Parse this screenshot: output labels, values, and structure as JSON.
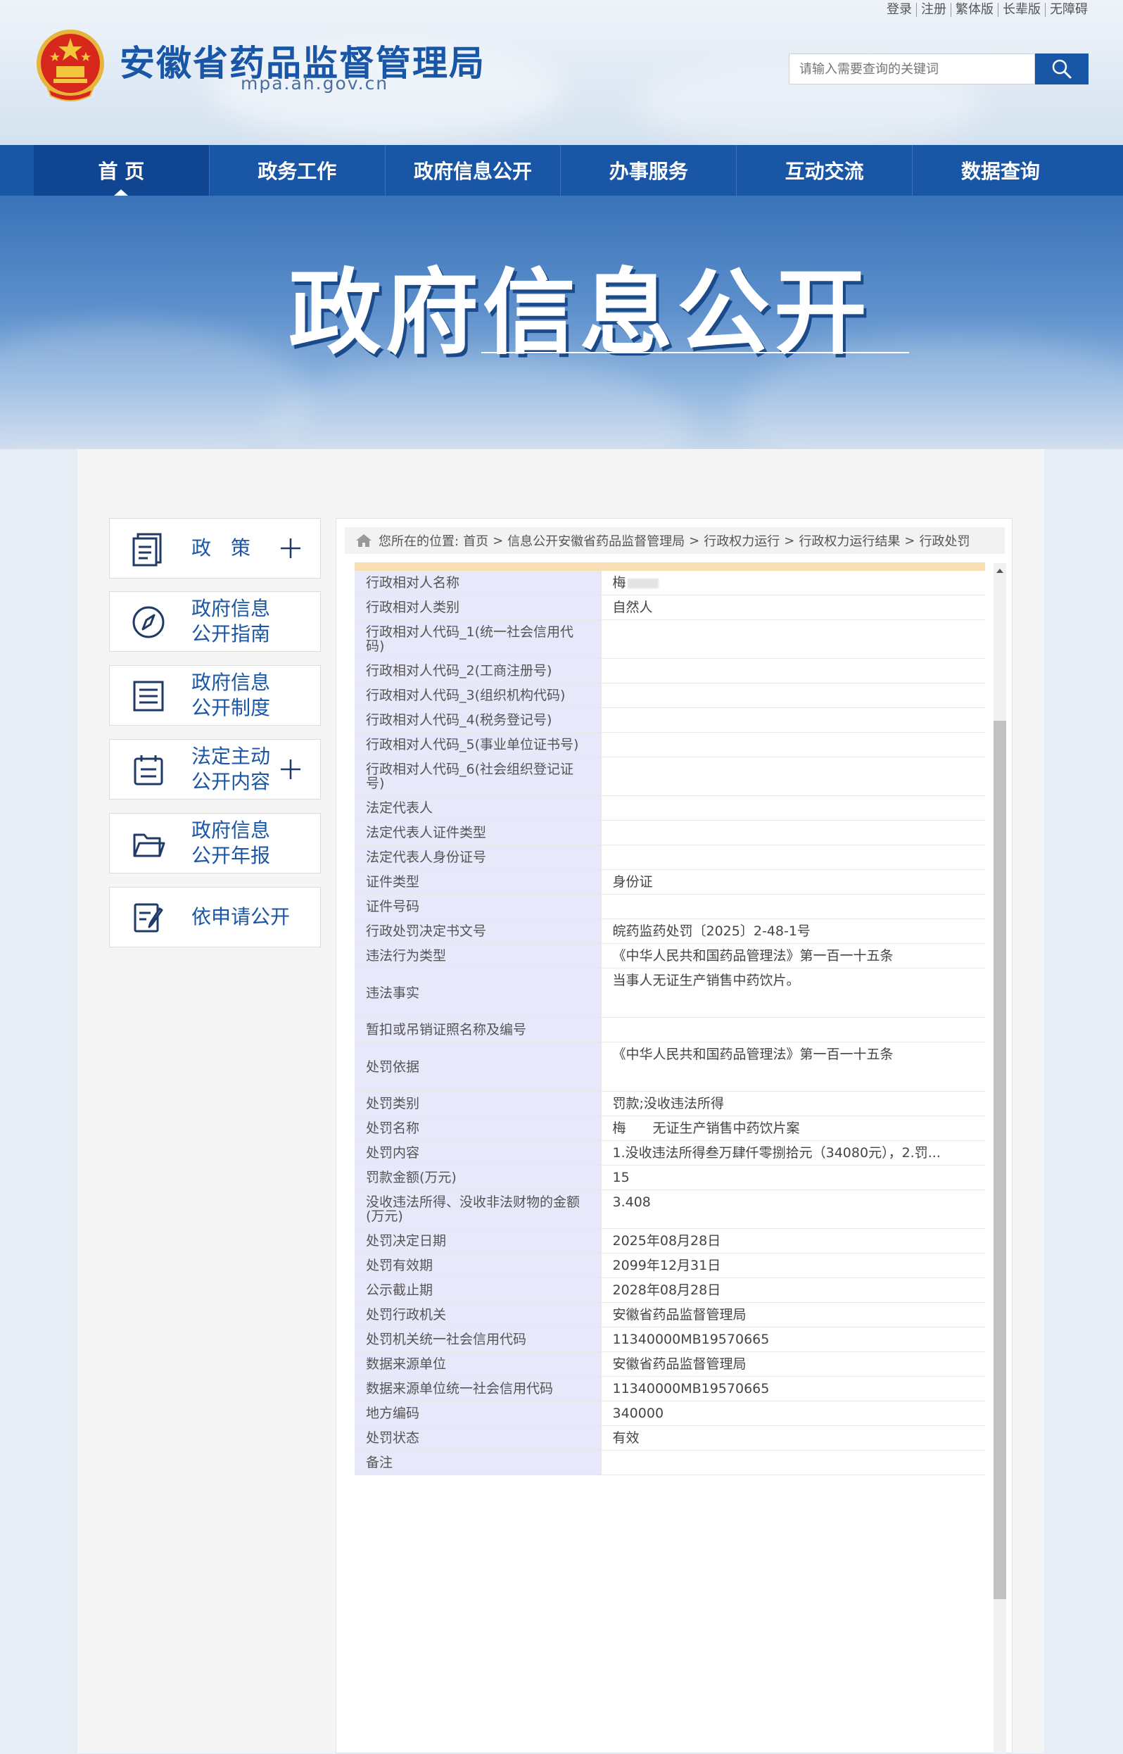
{
  "header": {
    "top_links": [
      "登录",
      "注册",
      "繁体版",
      "长辈版",
      "无障碍"
    ],
    "site_title": "安徽省药品监督管理局",
    "site_url": "mpa.ah.gov.cn",
    "search_placeholder": "请输入需要查询的关键词"
  },
  "nav": {
    "items": [
      "首 页",
      "政务工作",
      "政府信息公开",
      "办事服务",
      "互动交流",
      "数据查询"
    ],
    "active": 0
  },
  "banner": {
    "title": "政府信息公开"
  },
  "sidebar": {
    "items": [
      {
        "label": "政　策",
        "icon": "document-stack-icon",
        "expandable": true
      },
      {
        "label": "政府信息公开指南",
        "icon": "compass-icon",
        "expandable": false
      },
      {
        "label": "政府信息公开制度",
        "icon": "list-document-icon",
        "expandable": false
      },
      {
        "label": "法定主动公开内容",
        "icon": "clipboard-icon",
        "expandable": true
      },
      {
        "label": "政府信息公开年报",
        "icon": "folder-icon",
        "expandable": false
      },
      {
        "label": "依申请公开",
        "icon": "edit-form-icon",
        "expandable": false
      }
    ]
  },
  "breadcrumb": {
    "prefix": "您所在的位置:",
    "items": [
      "首页",
      "信息公开安徽省药品监督管理局",
      "行政权力运行",
      "行政权力运行结果",
      "行政处罚"
    ],
    "separator": ">"
  },
  "record": {
    "rows": [
      {
        "key": "行政相对人名称",
        "value": "梅",
        "redacted": true
      },
      {
        "key": "行政相对人类别",
        "value": "自然人"
      },
      {
        "key": "行政相对人代码_1(统一社会信用代码)",
        "value": ""
      },
      {
        "key": "行政相对人代码_2(工商注册号)",
        "value": ""
      },
      {
        "key": "行政相对人代码_3(组织机构代码)",
        "value": ""
      },
      {
        "key": "行政相对人代码_4(税务登记号)",
        "value": ""
      },
      {
        "key": "行政相对人代码_5(事业单位证书号)",
        "value": ""
      },
      {
        "key": "行政相对人代码_6(社会组织登记证号)",
        "value": ""
      },
      {
        "key": "法定代表人",
        "value": ""
      },
      {
        "key": "法定代表人证件类型",
        "value": ""
      },
      {
        "key": "法定代表人身份证号",
        "value": ""
      },
      {
        "key": "证件类型",
        "value": "身份证"
      },
      {
        "key": "证件号码",
        "value": ""
      },
      {
        "key": "行政处罚决定书文号",
        "value": "皖药监药处罚〔2025〕2-48-1号"
      },
      {
        "key": "违法行为类型",
        "value": "《中华人民共和国药品管理法》第一百一十五条"
      },
      {
        "key": "违法事实",
        "value": "当事人无证生产销售中药饮片。",
        "tall": true
      },
      {
        "key": "暂扣或吊销证照名称及编号",
        "value": ""
      },
      {
        "key": "处罚依据",
        "value": "《中华人民共和国药品管理法》第一百一十五条",
        "tall": true
      },
      {
        "key": "处罚类别",
        "value": "罚款;没收违法所得"
      },
      {
        "key": "处罚名称",
        "value": "梅　　无证生产销售中药饮片案",
        "redacted": true
      },
      {
        "key": "处罚内容",
        "value": "1.没收违法所得叁万肆仟零捌拾元（34080元），2.罚..."
      },
      {
        "key": "罚款金额(万元)",
        "value": "15"
      },
      {
        "key": "没收违法所得、没收非法财物的金额(万元)",
        "value": "3.408"
      },
      {
        "key": "处罚决定日期",
        "value": "2025年08月28日"
      },
      {
        "key": "处罚有效期",
        "value": "2099年12月31日"
      },
      {
        "key": "公示截止期",
        "value": "2028年08月28日"
      },
      {
        "key": "处罚行政机关",
        "value": "安徽省药品监督管理局"
      },
      {
        "key": "处罚机关统一社会信用代码",
        "value": "11340000MB19570665"
      },
      {
        "key": "数据来源单位",
        "value": "安徽省药品监督管理局"
      },
      {
        "key": "数据来源单位统一社会信用代码",
        "value": "11340000MB19570665"
      },
      {
        "key": "地方编码",
        "value": "340000"
      },
      {
        "key": "处罚状态",
        "value": "有效"
      },
      {
        "key": "备注",
        "value": ""
      }
    ]
  },
  "colors": {
    "brand_blue": "#1a56a6",
    "nav_active": "#0f4591",
    "key_cell_bg": "#e8e8fb",
    "table_top_bar": "#f8dfb3"
  }
}
